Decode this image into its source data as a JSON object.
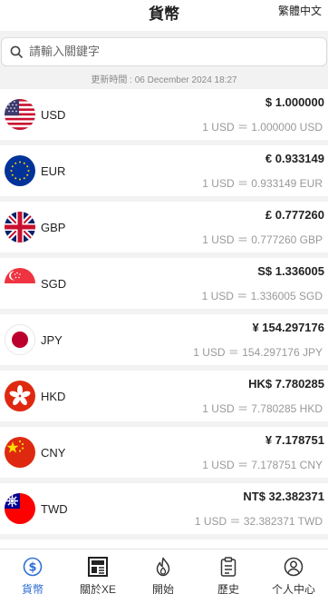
{
  "header": {
    "title": "貨幣",
    "lang_toggle": "繁體中文"
  },
  "search": {
    "placeholder": "請輸入關鍵字"
  },
  "update_time": "更新時間 : 06 December 2024 18:27",
  "currencies": [
    {
      "code": "USD",
      "amount": "$ 1.000000",
      "conversion": "1 USD ＝ 1.000000  USD",
      "flag_icon": "us-flag-icon"
    },
    {
      "code": "EUR",
      "amount": "€ 0.933149",
      "conversion": "1 USD ＝ 0.933149  EUR",
      "flag_icon": "eu-flag-icon"
    },
    {
      "code": "GBP",
      "amount": "£ 0.777260",
      "conversion": "1 USD ＝ 0.777260  GBP",
      "flag_icon": "uk-flag-icon"
    },
    {
      "code": "SGD",
      "amount": "S$ 1.336005",
      "conversion": "1 USD ＝ 1.336005  SGD",
      "flag_icon": "sg-flag-icon"
    },
    {
      "code": "JPY",
      "amount": "¥ 154.297176",
      "conversion": "1 USD ＝ 154.297176  JPY",
      "flag_icon": "jp-flag-icon"
    },
    {
      "code": "HKD",
      "amount": "HK$ 7.780285",
      "conversion": "1 USD ＝ 7.780285  HKD",
      "flag_icon": "hk-flag-icon"
    },
    {
      "code": "CNY",
      "amount": "¥ 7.178751",
      "conversion": "1 USD ＝ 7.178751  CNY",
      "flag_icon": "cn-flag-icon"
    },
    {
      "code": "TWD",
      "amount": "NT$ 32.382371",
      "conversion": "1 USD ＝ 32.382371  TWD",
      "flag_icon": "tw-flag-icon"
    }
  ],
  "tabbar": {
    "items": [
      {
        "label": "貨幣",
        "icon": "dollar-circle-icon",
        "active": true
      },
      {
        "label": "關於XE",
        "icon": "newspaper-icon",
        "active": false
      },
      {
        "label": "開始",
        "icon": "flame-icon",
        "active": false
      },
      {
        "label": "歷史",
        "icon": "clipboard-icon",
        "active": false
      },
      {
        "label": "个人中心",
        "icon": "user-icon",
        "active": false
      }
    ]
  },
  "colors": {
    "accent": "#2f6fd6",
    "background": "#f2f2f2",
    "muted_text": "#999999"
  }
}
